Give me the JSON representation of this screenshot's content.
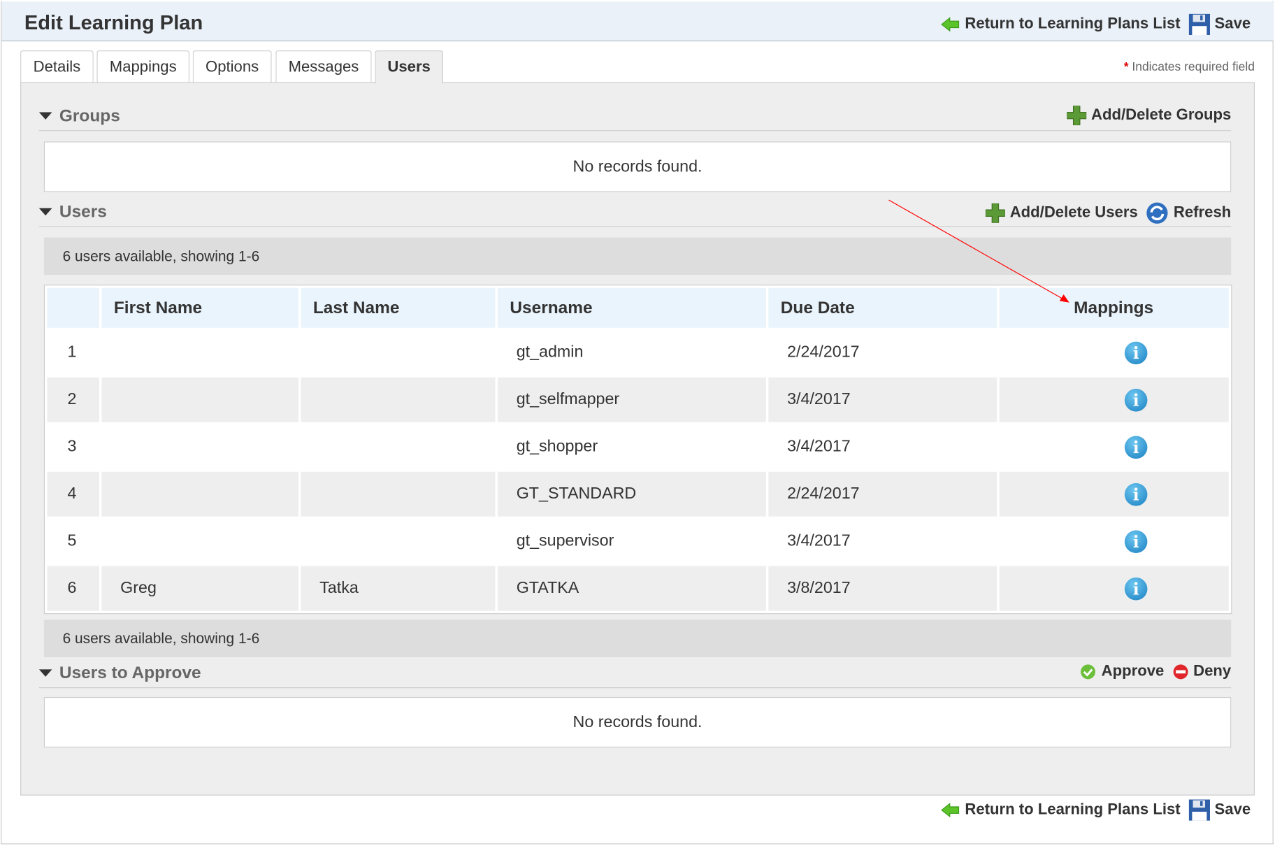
{
  "header": {
    "title": "Edit Learning Plan",
    "return_label": "Return to Learning Plans List",
    "save_label": "Save"
  },
  "tabs": [
    {
      "label": "Details"
    },
    {
      "label": "Mappings"
    },
    {
      "label": "Options"
    },
    {
      "label": "Messages"
    },
    {
      "label": "Users",
      "active": true
    }
  ],
  "required_note": {
    "asterisk": "*",
    "text": "Indicates required field"
  },
  "groups": {
    "title": "Groups",
    "add_label": "Add/Delete Groups",
    "empty": "No records found."
  },
  "users": {
    "title": "Users",
    "add_label": "Add/Delete Users",
    "refresh_label": "Refresh",
    "pager": "6 users available, showing 1-6",
    "columns": [
      "",
      "First Name",
      "Last Name",
      "Username",
      "Due Date",
      "Mappings"
    ],
    "rows": [
      {
        "num": "1",
        "first": "",
        "last": "",
        "username": "gt_admin",
        "due": "2/24/2017"
      },
      {
        "num": "2",
        "first": "",
        "last": "",
        "username": "gt_selfmapper",
        "due": "3/4/2017"
      },
      {
        "num": "3",
        "first": "",
        "last": "",
        "username": "gt_shopper",
        "due": "3/4/2017"
      },
      {
        "num": "4",
        "first": "",
        "last": "",
        "username": "GT_STANDARD",
        "due": "2/24/2017"
      },
      {
        "num": "5",
        "first": "",
        "last": "",
        "username": "gt_supervisor",
        "due": "3/4/2017"
      },
      {
        "num": "6",
        "first": "Greg",
        "last": "Tatka",
        "username": "GTATKA",
        "due": "3/8/2017"
      }
    ]
  },
  "approve": {
    "title": "Users to Approve",
    "approve_label": "Approve",
    "deny_label": "Deny",
    "empty": "No records found."
  },
  "footer": {
    "return_label": "Return to Learning Plans List",
    "save_label": "Save"
  },
  "colors": {
    "header_bg": "#eaf1f9",
    "panel_bg": "#eeeeee",
    "table_header_bg": "#eaf4fc",
    "annotation": "#ff0000"
  }
}
